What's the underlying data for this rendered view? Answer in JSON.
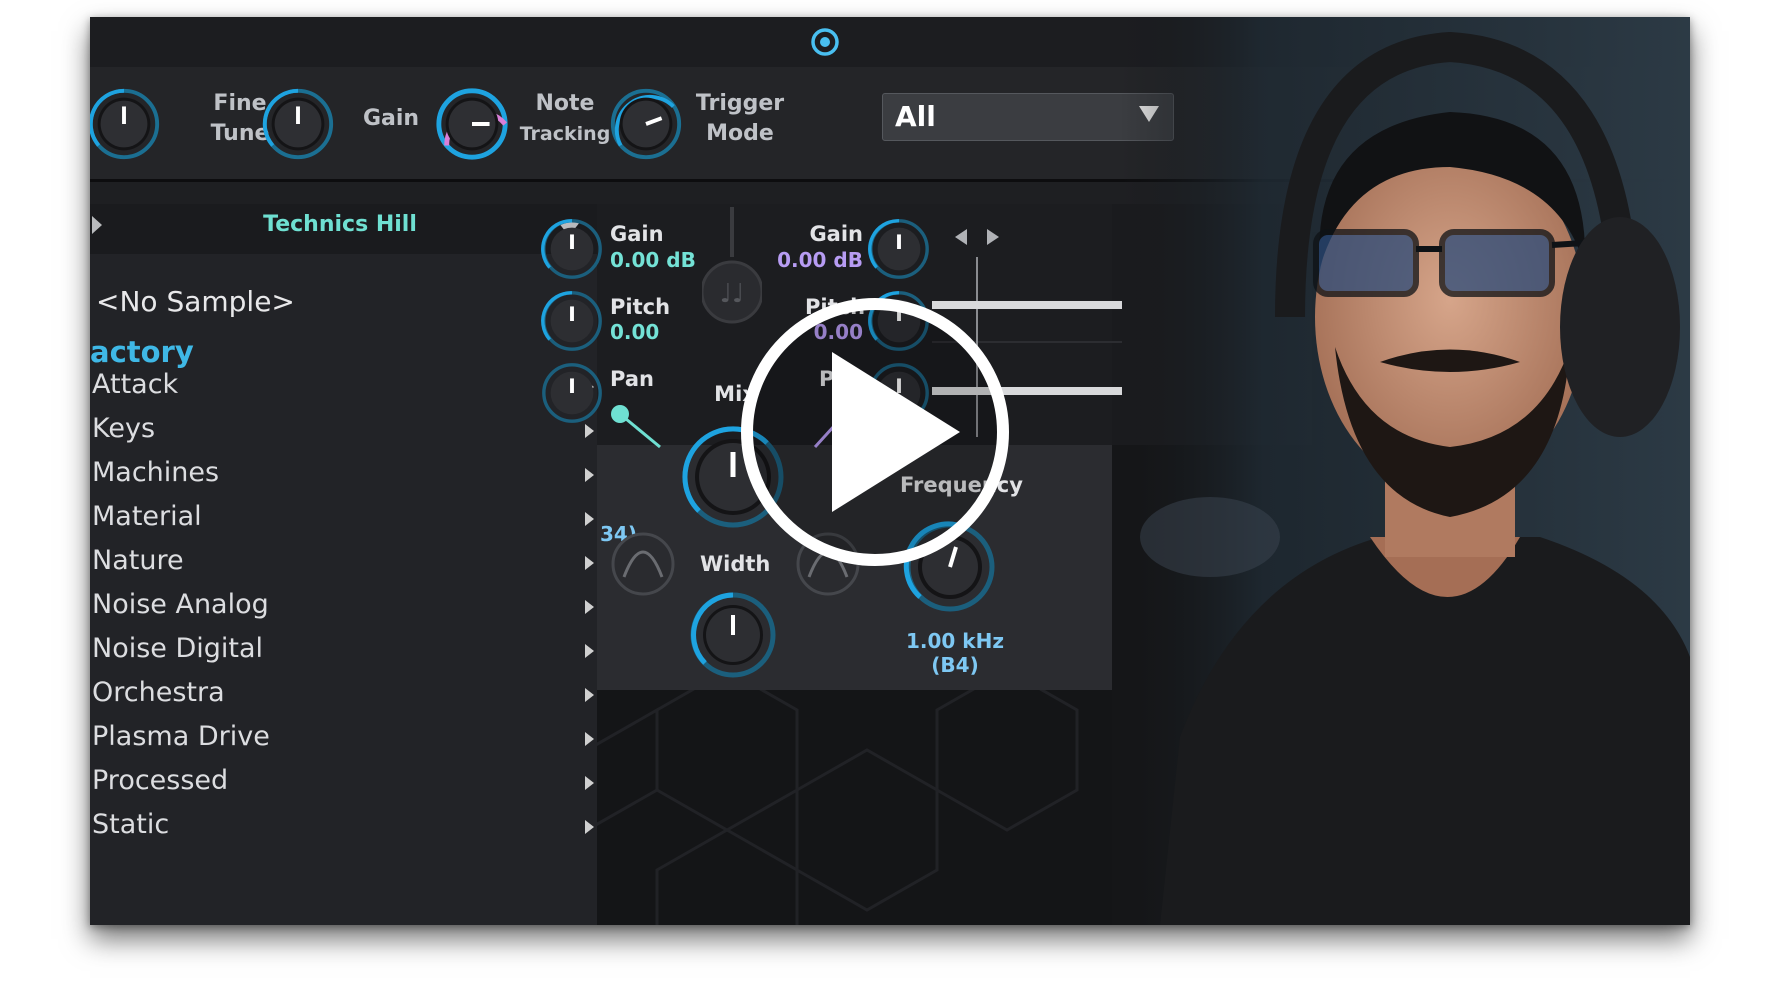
{
  "header": {
    "knobs": [
      {
        "label": "Fine\nTune"
      },
      {
        "label": "Gain"
      },
      {
        "label": "Note\nTracking"
      }
    ],
    "fine_tune_label_1": "Fine",
    "fine_tune_label_2": "Tune",
    "gain_label": "Gain",
    "note_label_1": "Note",
    "note_label_2": "Tracking",
    "trigger_label_1": "Trigger",
    "trigger_label_2": "Mode",
    "trigger_mode_value": "All"
  },
  "browser": {
    "title": "Technics Hill",
    "no_sample": "<No Sample>",
    "section": "actory",
    "categories": [
      "Attack",
      "Keys",
      "Machines",
      "Material",
      "Nature",
      "Noise Analog",
      "Noise Digital",
      "Orchestra",
      "Plasma Drive",
      "Processed",
      "Static"
    ]
  },
  "left_channel": {
    "gain_label": "Gain",
    "gain_value": "0.00 dB",
    "pitch_label": "Pitch",
    "pitch_value": "0.00",
    "pan_label": "Pan"
  },
  "right_channel": {
    "gain_label": "Gain",
    "gain_value": "0.00 dB",
    "pitch_label": "Pitch",
    "pitch_value": "0.00",
    "pan_label": "Pan"
  },
  "mixer": {
    "mix_label": "Mix",
    "width_label": "Width",
    "frequency_label": "Frequency",
    "frequency_value": "1.00 kHz (B4)",
    "partial_value": "34)"
  },
  "colors": {
    "accent_cyan": "#3fb8e6",
    "teal_text": "#6fe0d2",
    "purple_text": "#b79cf3",
    "knob_ring": "#1ea3e0",
    "gain_ring": "#d97fd8"
  },
  "icons": [
    "plugin-logo-icon",
    "play-icon",
    "waveform-icon",
    "filter-peak-icon",
    "note-icon"
  ]
}
